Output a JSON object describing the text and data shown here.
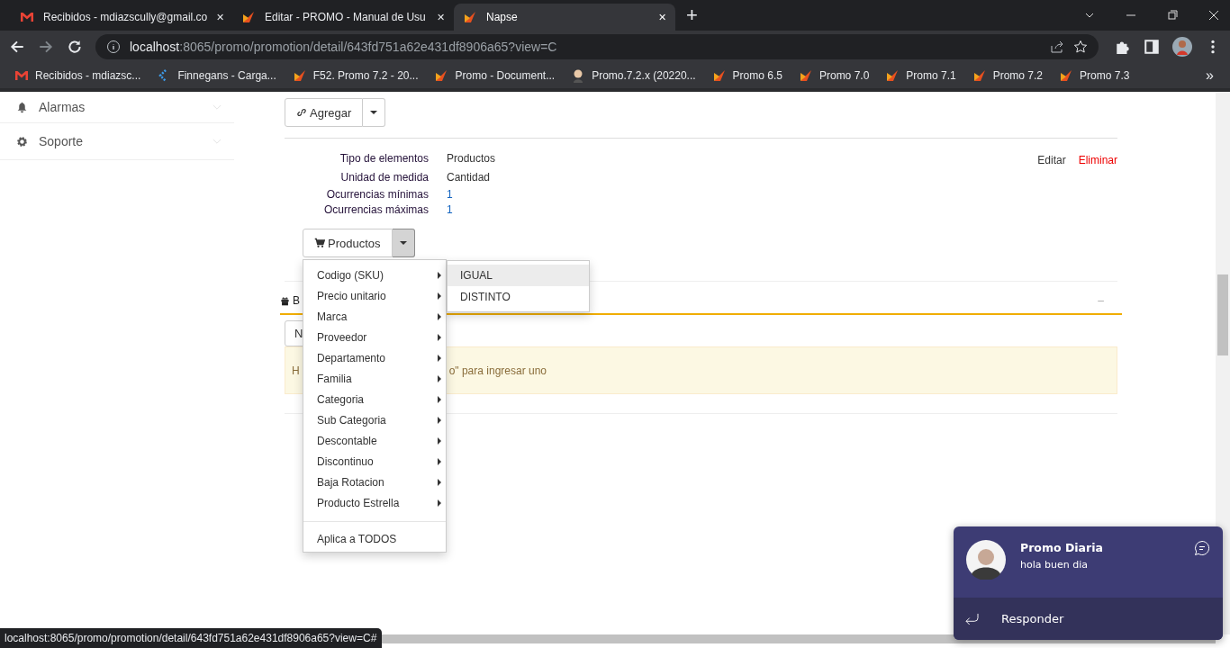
{
  "browser": {
    "tabs": [
      {
        "title": "Recibidos - mdiazscully@gmail.co",
        "kind": "mail",
        "selected": false
      },
      {
        "title": "Editar - PROMO - Manual de Usu",
        "kind": "promo",
        "selected": false
      },
      {
        "title": "Napse",
        "kind": "promo",
        "selected": true
      }
    ],
    "address": {
      "host": "localhost",
      "path": ":8065/promo/promotion/detail/643fd751a62e431df8906a65?view=C"
    },
    "close_mark": "✕",
    "new_tab": "+",
    "more_bookmarks": "»",
    "bookmarks": [
      {
        "label": "Recibidos - mdiazsc...",
        "kind": "mail"
      },
      {
        "label": "Finnegans - Carga...",
        "kind": "chevron"
      },
      {
        "label": "F52. Promo 7.2 - 20...",
        "kind": "promo"
      },
      {
        "label": "Promo - Document...",
        "kind": "promo"
      },
      {
        "label": "Promo.7.2.x (20220...",
        "kind": "person"
      },
      {
        "label": "Promo 6.5",
        "kind": "promo"
      },
      {
        "label": "Promo 7.0",
        "kind": "promo"
      },
      {
        "label": "Promo 7.1",
        "kind": "promo"
      },
      {
        "label": "Promo 7.2",
        "kind": "promo"
      },
      {
        "label": "Promo 7.3",
        "kind": "promo"
      }
    ]
  },
  "sidebar": {
    "items": [
      {
        "label": "Alarmas",
        "kind": "bell"
      },
      {
        "label": "Soporte",
        "kind": "gear"
      }
    ]
  },
  "add_button": "Agregar",
  "details": [
    {
      "label": "Tipo de elementos",
      "value": "Productos",
      "kind": "text"
    },
    {
      "label": "Unidad de medida",
      "value": "Cantidad",
      "kind": "text"
    },
    {
      "label": "Ocurrencias mínimas",
      "value": "1",
      "kind": "link"
    },
    {
      "label": "Ocurrencias máximas",
      "value": "1",
      "kind": "link"
    }
  ],
  "actions": {
    "edit": "Editar",
    "delete": "Eliminar"
  },
  "products_button": "Productos",
  "menu": {
    "items": [
      {
        "label": "Codigo (SKU)",
        "kind": "submenu"
      },
      {
        "label": "Precio unitario",
        "kind": "submenu"
      },
      {
        "label": "Marca",
        "kind": "submenu"
      },
      {
        "label": "Proveedor",
        "kind": "submenu"
      },
      {
        "label": "Departamento",
        "kind": "submenu"
      },
      {
        "label": "Familia",
        "kind": "submenu"
      },
      {
        "label": "Categoria",
        "kind": "submenu"
      },
      {
        "label": "Sub Categoria",
        "kind": "submenu"
      },
      {
        "label": "Descontable",
        "kind": "submenu"
      },
      {
        "label": "Discontinuo",
        "kind": "submenu"
      },
      {
        "label": "Baja Rotacion",
        "kind": "submenu"
      },
      {
        "label": "Producto Estrella",
        "kind": "submenu"
      },
      {
        "label": "Aplica a TODOS",
        "kind": "action"
      }
    ],
    "submenu": [
      {
        "label": "IGUAL",
        "selected": true
      },
      {
        "label": "DISTINTO",
        "selected": false
      }
    ]
  },
  "section": {
    "title": "B",
    "collapse": "–",
    "button": "N",
    "alert_start": "H",
    "alert_end": "o\" para ingresar uno"
  },
  "notification": {
    "title": "Promo Diaria",
    "message": "hola buen dia",
    "reply": "Responder"
  },
  "status_url": "localhost:8065/promo/promotion/detail/643fd751a62e431df8906a65?view=C#"
}
